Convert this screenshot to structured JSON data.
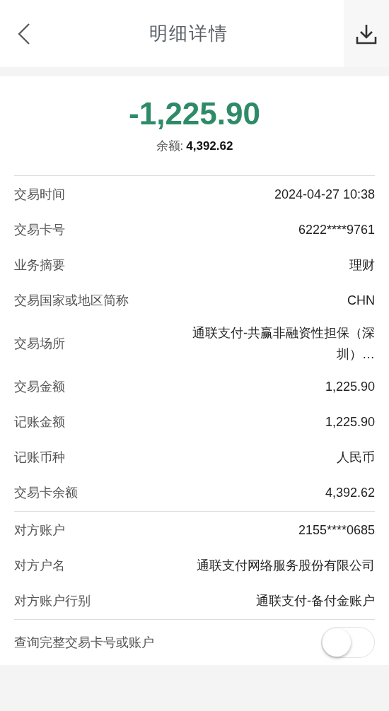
{
  "header": {
    "title": "明细详情"
  },
  "summary": {
    "amount": "-1,225.90",
    "balance_label": "余额:",
    "balance_value": "4,392.62"
  },
  "sections": [
    {
      "rows": [
        {
          "label": "交易时间",
          "value": "2024-04-27 10:38"
        },
        {
          "label": "交易卡号",
          "value": "6222****9761"
        },
        {
          "label": "业务摘要",
          "value": "理财"
        },
        {
          "label": "交易国家或地区简称",
          "value": "CHN"
        },
        {
          "label": "交易场所",
          "value": "通联支付-共赢非融资性担保（深圳）…"
        },
        {
          "label": "交易金额",
          "value": "1,225.90"
        },
        {
          "label": "记账金额",
          "value": "1,225.90"
        },
        {
          "label": "记账币种",
          "value": "人民币"
        },
        {
          "label": "交易卡余额",
          "value": "4,392.62"
        }
      ]
    },
    {
      "rows": [
        {
          "label": "对方账户",
          "value": "2155****0685"
        },
        {
          "label": "对方户名",
          "value": "通联支付网络服务股份有限公司"
        },
        {
          "label": "对方账户行别",
          "value": "通联支付-备付金账户"
        }
      ]
    }
  ],
  "toggle": {
    "label": "查询完整交易卡号或账户",
    "on": false
  }
}
